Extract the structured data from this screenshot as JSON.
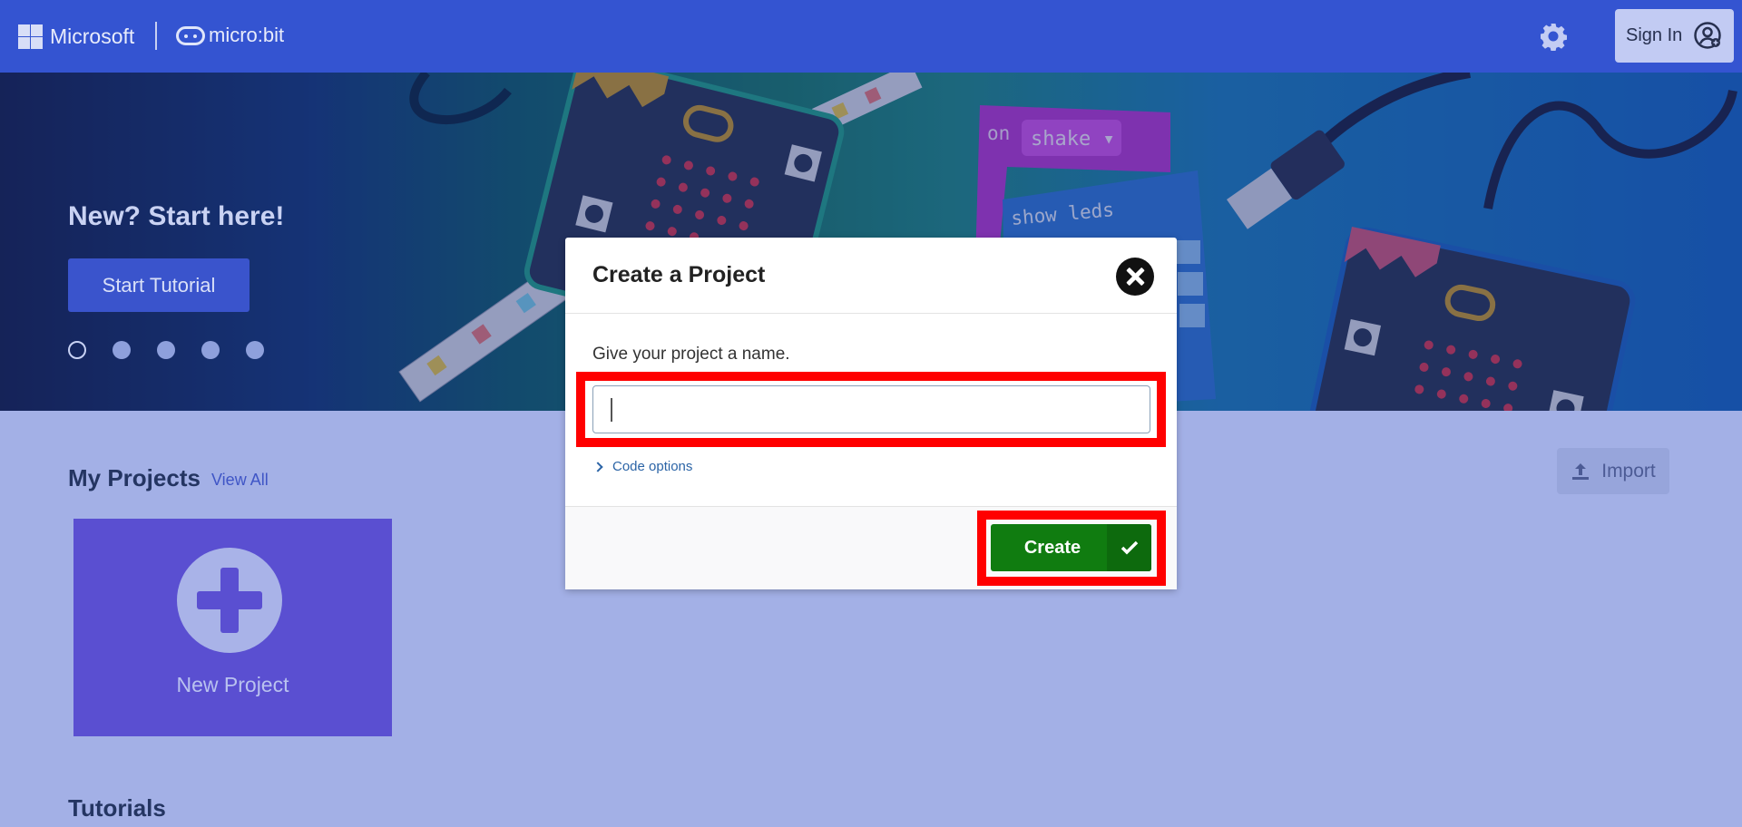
{
  "header": {
    "brand": "Microsoft",
    "product": "micro:bit",
    "signin_label": "Sign In"
  },
  "hero": {
    "title": "New? Start here!",
    "tutorial_button": "Start Tutorial",
    "carousel_dots": 5,
    "active_dot": 1,
    "blocks": {
      "on_label": "on",
      "shake_label": "shake",
      "show_leds_label": "show leds"
    }
  },
  "main": {
    "my_projects_title": "My Projects",
    "view_all": "View All",
    "import_label": "Import",
    "new_project_label": "New Project",
    "tutorials_title": "Tutorials"
  },
  "modal": {
    "title": "Create a Project",
    "prompt": "Give your project a name.",
    "name_value": "",
    "code_options": "Code options",
    "create_label": "Create"
  },
  "colors": {
    "header": "#3454d1",
    "create_button": "#107c10",
    "highlight": "#ff0000",
    "new_project_tile": "#5a4fd1"
  }
}
